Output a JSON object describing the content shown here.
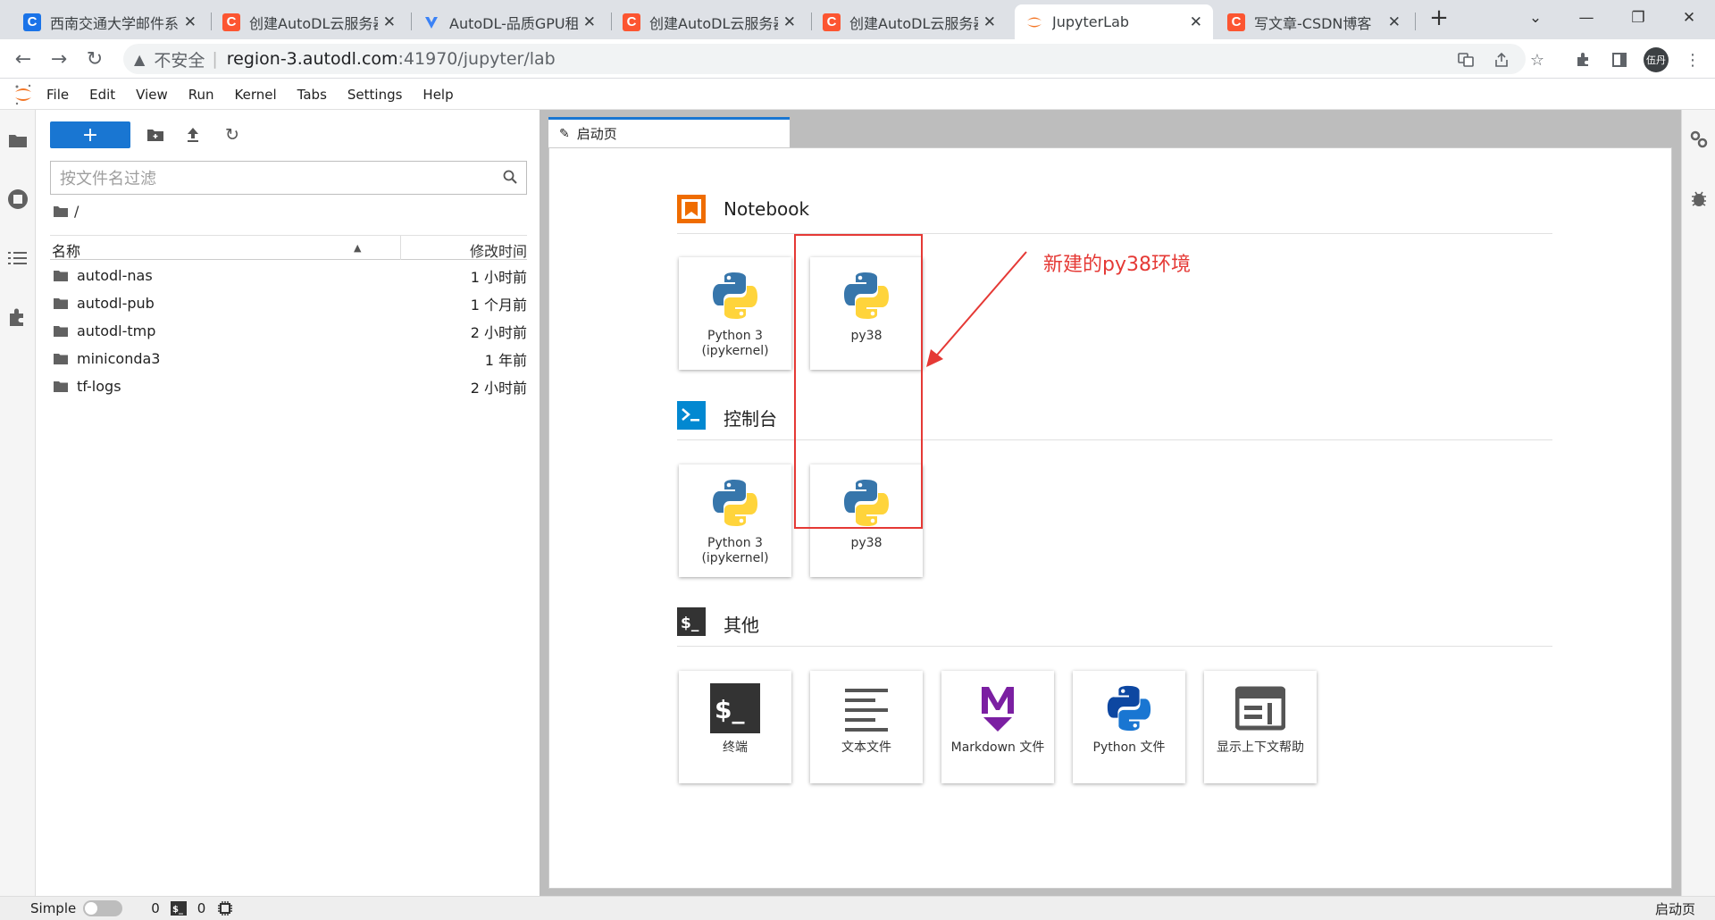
{
  "browser": {
    "tabs": [
      {
        "title": "西南交通大学邮件系统",
        "favicon": "C",
        "color": "#1a73e8"
      },
      {
        "title": "创建AutoDL云服务器",
        "favicon": "C",
        "color": "#fc5531"
      },
      {
        "title": "AutoDL-品质GPU租用",
        "favicon": "autodl-logo",
        "color": "#3b82f6"
      },
      {
        "title": "创建AutoDL云服务器",
        "favicon": "C",
        "color": "#fc5531"
      },
      {
        "title": "创建AutoDL云服务器",
        "favicon": "C",
        "color": "#fc5531"
      },
      {
        "title": "JupyterLab",
        "favicon": "jupyter-logo",
        "color": "#f37626",
        "active": true
      },
      {
        "title": "写文章-CSDN博客",
        "favicon": "C",
        "color": "#fc5531"
      }
    ],
    "insecure_label": "不安全",
    "url_host": "region-3.autodl.com",
    "url_path": ":41970/jupyter/lab",
    "profile_label": "伍丹"
  },
  "menu": [
    "File",
    "Edit",
    "View",
    "Run",
    "Kernel",
    "Tabs",
    "Settings",
    "Help"
  ],
  "filebrowser": {
    "new_label": "+",
    "filter_placeholder": "按文件名过滤",
    "breadcrumb": "/",
    "col_name": "名称",
    "col_modified": "修改时间",
    "items": [
      {
        "name": "autodl-nas",
        "modified": "1 小时前"
      },
      {
        "name": "autodl-pub",
        "modified": "1 个月前"
      },
      {
        "name": "autodl-tmp",
        "modified": "2 小时前"
      },
      {
        "name": "miniconda3",
        "modified": "1 年前"
      },
      {
        "name": "tf-logs",
        "modified": "2 小时前"
      }
    ]
  },
  "doc_tab": "启动页",
  "launcher": {
    "sections": [
      {
        "title": "Notebook",
        "cards": [
          "Python 3\n(ipykernel)",
          "py38"
        ]
      },
      {
        "title": "控制台",
        "cards": [
          "Python 3\n(ipykernel)",
          "py38"
        ]
      },
      {
        "title": "其他",
        "cards": [
          "终端",
          "文本文件",
          "Markdown 文件",
          "Python 文件",
          "显示上下文帮助"
        ]
      }
    ],
    "annotation": "新建的py38环境",
    "annotation_color": "#e53935"
  },
  "statusbar": {
    "mode_label": "Simple",
    "terminals": "0",
    "kernels": "0",
    "right_label": "启动页"
  }
}
